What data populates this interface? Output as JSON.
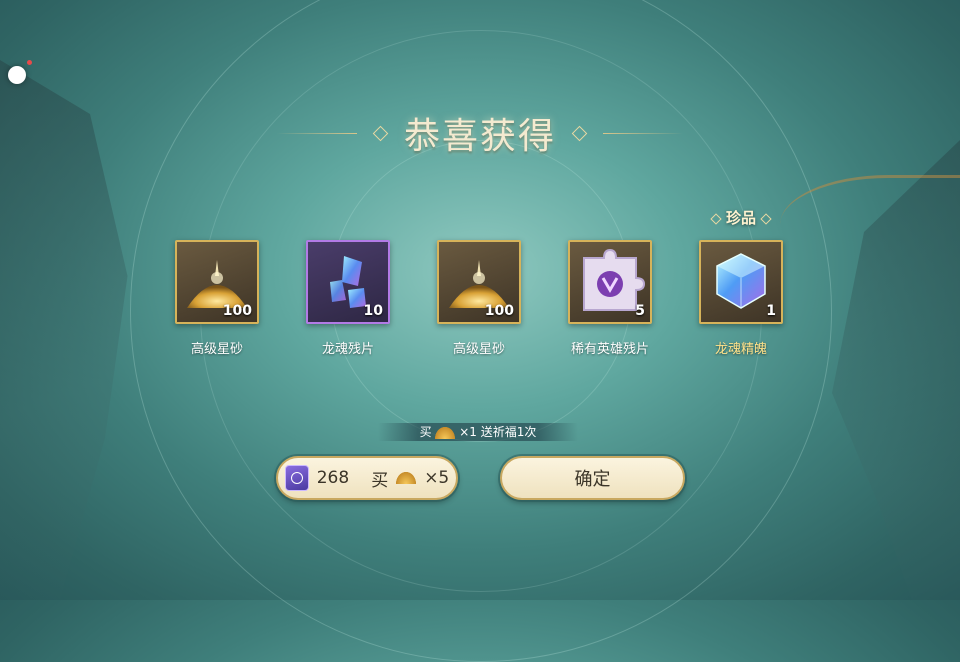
{
  "title": "恭喜获得",
  "items": [
    {
      "name": "高级星砂",
      "qty": "100",
      "icon": "star-sand-icon",
      "rarity": "gold"
    },
    {
      "name": "龙魂残片",
      "qty": "10",
      "icon": "dragon-soul-shard-icon",
      "rarity": "purple"
    },
    {
      "name": "高级星砂",
      "qty": "100",
      "icon": "star-sand-icon",
      "rarity": "gold"
    },
    {
      "name": "稀有英雄残片",
      "qty": "5",
      "icon": "hero-fragment-icon",
      "rarity": "gold"
    },
    {
      "name": "龙魂精魄",
      "qty": "1",
      "icon": "dragon-soul-gem-icon",
      "rarity": "gold",
      "tag": "珍品"
    }
  ],
  "promo": {
    "prefix": "买",
    "count": "×1",
    "suffix": "送祈福1次"
  },
  "buy_button": {
    "cost": "268",
    "label_prefix": "买",
    "label_count": "×5"
  },
  "confirm_button": {
    "label": "确定"
  },
  "colors": {
    "accent_gold": "#d6b35a",
    "rare_purple": "#b27be6",
    "button_bg": "#fbf4df"
  }
}
